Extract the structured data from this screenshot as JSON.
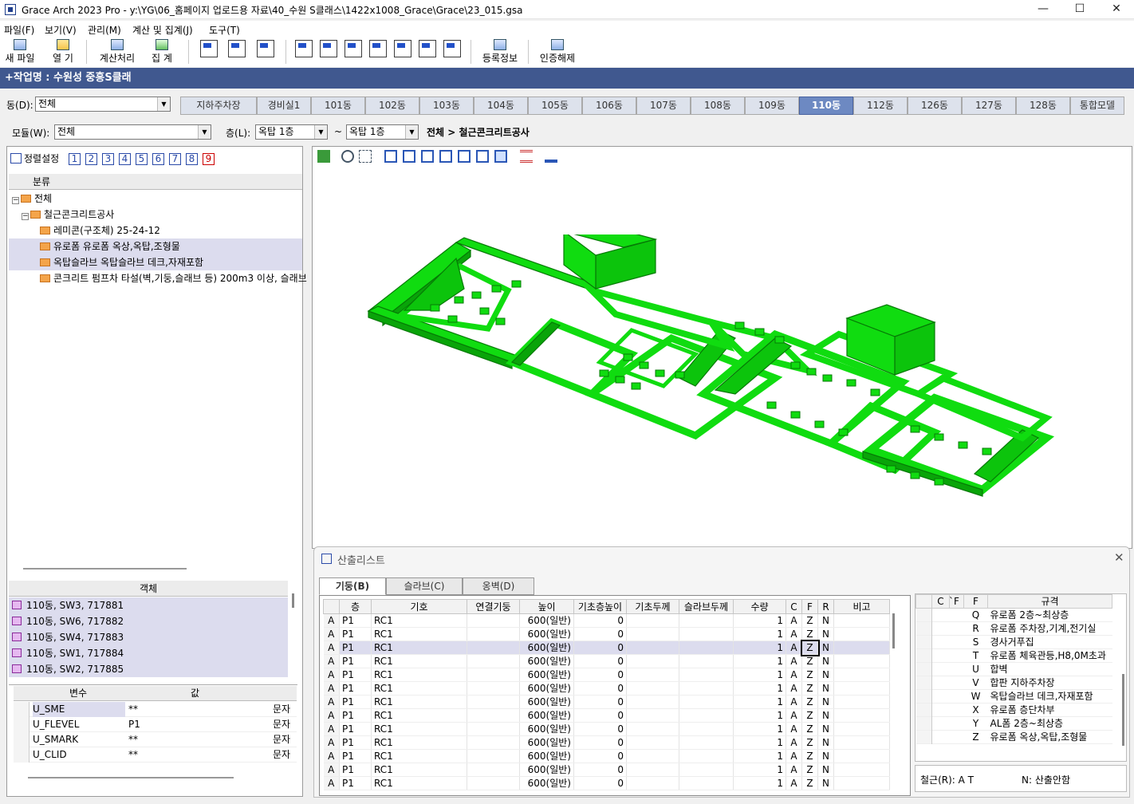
{
  "window": {
    "title": "Grace Arch 2023 Pro - y:\\YG\\06_홈페이지 업로드용 자료\\40_수원 S클래스\\1422x1008_Grace\\Grace\\23_015.gsa",
    "min": "—",
    "max": "☐",
    "close": "✕"
  },
  "menu": [
    "파일(F)",
    "보기(V)",
    "관리(M)",
    "계산 및 집계(J)",
    "도구(T)"
  ],
  "toolbar": {
    "new": "새 파일",
    "open": "열  기",
    "calc": "계산처리",
    "total": "집  계",
    "register": "등록정보",
    "auth": "인증해제"
  },
  "work": {
    "title": "+작업명 : 수원성 중흥S클래"
  },
  "dong": {
    "label": "동(D):",
    "value": "전체",
    "tabs": [
      "지하주차장",
      "경비실1",
      "101동",
      "102동",
      "103동",
      "104동",
      "105동",
      "106동",
      "107동",
      "108동",
      "109동",
      "110동",
      "112동",
      "126동",
      "127동",
      "128동",
      "통합모델"
    ],
    "active": "110동"
  },
  "module": {
    "label": "모듈(W):",
    "value": "전체",
    "floor_label": "층(L):",
    "floor_from": "옥탑 1층",
    "tilde": "~",
    "floor_to": "옥탑 1층",
    "path": "전체 > 철근콘크리트공사"
  },
  "left": {
    "sort_label": "정렬설정",
    "nums": [
      "1",
      "2",
      "3",
      "4",
      "5",
      "6",
      "7",
      "8",
      "9"
    ],
    "tree_header": "분류",
    "tree": [
      {
        "t": "전체",
        "lvl": 0,
        "exp": "−"
      },
      {
        "t": "철근콘크리트공사",
        "lvl": 1,
        "exp": "−"
      },
      {
        "t": "레미콘(구조체)  25-24-12",
        "lvl": 2
      },
      {
        "t": "유로폼  유로폼 옥상,옥탑,조형물",
        "lvl": 2,
        "sel": true
      },
      {
        "t": "옥탑슬라브  옥탑슬라브 데크,자재포함",
        "lvl": 2,
        "sel": true
      },
      {
        "t": "콘크리트 펌프차 타설(벽,기둥,슬래브 등)  200m3 이상, 슬래브",
        "lvl": 2
      }
    ],
    "obj_header": "객체",
    "objects": [
      "110동, SW3, 717881",
      "110동, SW6, 717882",
      "110동, SW4, 717883",
      "110동, SW1, 717884",
      "110동, SW2, 717885"
    ],
    "var_header": {
      "name": "변수",
      "val": "값"
    },
    "vars": [
      {
        "n": "U_SME",
        "v": "**",
        "t": "문자"
      },
      {
        "n": "U_FLEVEL",
        "v": "P1",
        "t": "문자"
      },
      {
        "n": "U_SMARK",
        "v": "**",
        "t": "문자"
      },
      {
        "n": "U_CLID",
        "v": "**",
        "t": "문자"
      }
    ]
  },
  "calc": {
    "title": "산출리스트",
    "tabs": [
      "기둥(B)",
      "슬라브(C)",
      "옹벽(D)"
    ],
    "columns": [
      "",
      "층",
      "기호",
      "연결기둥",
      "높이",
      "기초층높이",
      "기초두께",
      "슬라브두께",
      "수량",
      "C",
      "F",
      "R",
      "비고"
    ],
    "rows": [
      [
        "A",
        "P1",
        "RC1",
        "",
        "600(일반)",
        "0",
        "",
        "",
        "1",
        "A",
        "Z",
        "N",
        ""
      ],
      [
        "A",
        "P1",
        "RC1",
        "",
        "600(일반)",
        "0",
        "",
        "",
        "1",
        "A",
        "Z",
        "N",
        ""
      ],
      [
        "A",
        "P1",
        "RC1",
        "",
        "600(일반)",
        "0",
        "",
        "",
        "1",
        "A",
        "Z",
        "N",
        ""
      ],
      [
        "A",
        "P1",
        "RC1",
        "",
        "600(일반)",
        "0",
        "",
        "",
        "1",
        "A",
        "Z",
        "N",
        ""
      ],
      [
        "A",
        "P1",
        "RC1",
        "",
        "600(일반)",
        "0",
        "",
        "",
        "1",
        "A",
        "Z",
        "N",
        ""
      ],
      [
        "A",
        "P1",
        "RC1",
        "",
        "600(일반)",
        "0",
        "",
        "",
        "1",
        "A",
        "Z",
        "N",
        ""
      ],
      [
        "A",
        "P1",
        "RC1",
        "",
        "600(일반)",
        "0",
        "",
        "",
        "1",
        "A",
        "Z",
        "N",
        ""
      ],
      [
        "A",
        "P1",
        "RC1",
        "",
        "600(일반)",
        "0",
        "",
        "",
        "1",
        "A",
        "Z",
        "N",
        ""
      ],
      [
        "A",
        "P1",
        "RC1",
        "",
        "600(일반)",
        "0",
        "",
        "",
        "1",
        "A",
        "Z",
        "N",
        ""
      ],
      [
        "A",
        "P1",
        "RC1",
        "",
        "600(일반)",
        "0",
        "",
        "",
        "1",
        "A",
        "Z",
        "N",
        ""
      ],
      [
        "A",
        "P1",
        "RC1",
        "",
        "600(일반)",
        "0",
        "",
        "",
        "1",
        "A",
        "Z",
        "N",
        ""
      ],
      [
        "A",
        "P1",
        "RC1",
        "",
        "600(일반)",
        "0",
        "",
        "",
        "1",
        "A",
        "Z",
        "N",
        ""
      ],
      [
        "A",
        "P1",
        "RC1",
        "",
        "600(일반)",
        "0",
        "",
        "",
        "1",
        "A",
        "Z",
        "N",
        ""
      ]
    ],
    "spec_cols": [
      "C",
      "̀F",
      "F",
      "규격"
    ],
    "specs": [
      [
        "Q",
        "유로폼 2층~최상층"
      ],
      [
        "R",
        "유로폼 주차장,기계,전기실"
      ],
      [
        "S",
        "경사거푸집"
      ],
      [
        "T",
        "유로폼 체육관등,H8,0M초과"
      ],
      [
        "U",
        "합벽"
      ],
      [
        "V",
        "합판 지하주차장"
      ],
      [
        "W",
        "옥탑슬라브 데크,자재포함"
      ],
      [
        "X",
        "유로폼 층단차부"
      ],
      [
        "Y",
        "AL폼 2층~최상층"
      ],
      [
        "Z",
        "유로폼 옥상,옥탑,조형물"
      ]
    ],
    "footer": {
      "rebar": "철근(R): A T",
      "n_label": "N: 산출안함"
    }
  },
  "colors": {
    "model": "#0fd80f",
    "modelDark": "#079a07",
    "accent": "#40588f",
    "tabActive": "#6d89c2"
  }
}
